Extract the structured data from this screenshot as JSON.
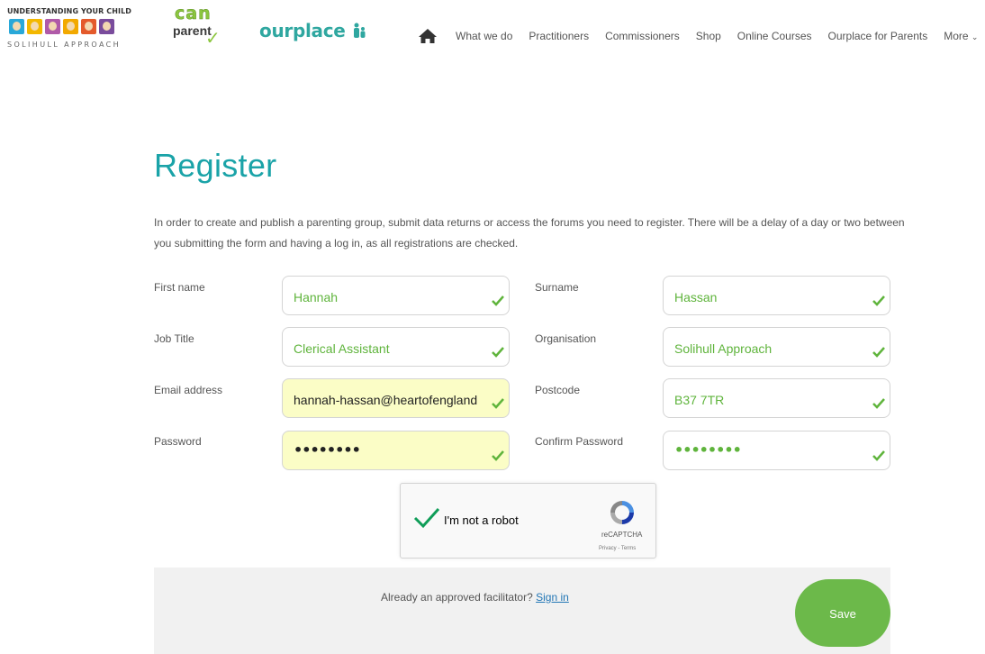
{
  "header": {
    "logo1_title": "UNDERSTANDING YOUR CHILD",
    "logo1_sub": "SOLIHULL APPROACH",
    "logo2_can": "can",
    "logo2_parent": "parent",
    "logo3": "ourplace",
    "nav": [
      "What we do",
      "Practitioners",
      "Commissioners",
      "Shop",
      "Online Courses",
      "Ourplace for Parents",
      "More"
    ],
    "colors": {
      "teal": "#1aa3a8",
      "green": "#6cb94a",
      "ourplace": "#2fa7a0"
    }
  },
  "page": {
    "title": "Register",
    "intro": "In order to create and publish a parenting group, submit data returns or access the forums you need to register. There will be a delay of a day or two between you submitting the form and having a log in, as all registrations are checked."
  },
  "form": {
    "first_name": {
      "label": "First name",
      "value": "Hannah"
    },
    "surname": {
      "label": "Surname",
      "value": "Hassan"
    },
    "job_title": {
      "label": "Job Title",
      "value": "Clerical Assistant"
    },
    "organisation": {
      "label": "Organisation",
      "value": "Solihull Approach"
    },
    "email": {
      "label": "Email address",
      "value": "hannah-hassan@heartofengland"
    },
    "postcode": {
      "label": "Postcode",
      "value": "B37 7TR"
    },
    "password": {
      "label": "Password",
      "value": "••••••••"
    },
    "confirm_password": {
      "label": "Confirm Password",
      "value": "••••••••"
    }
  },
  "captcha": {
    "label": "I'm not a robot",
    "brand": "reCAPTCHA",
    "terms": "Privacy - Terms"
  },
  "footer": {
    "question": "Already an approved facilitator?",
    "sign_in": "Sign in",
    "save": "Save"
  }
}
